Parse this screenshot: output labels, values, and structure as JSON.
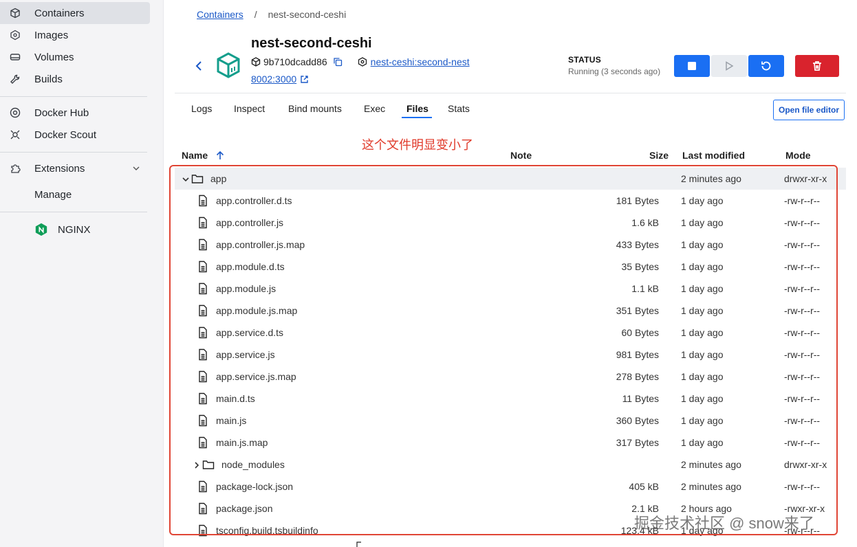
{
  "sidebar": {
    "items": [
      {
        "label": "Containers",
        "icon": "box-icon"
      },
      {
        "label": "Images",
        "icon": "image-icon"
      },
      {
        "label": "Volumes",
        "icon": "volume-icon"
      },
      {
        "label": "Builds",
        "icon": "wrench-icon"
      },
      {
        "label": "Docker Hub",
        "icon": "hub-icon"
      },
      {
        "label": "Docker Scout",
        "icon": "scout-icon"
      },
      {
        "label": "Extensions",
        "icon": "puzzle-icon"
      },
      {
        "label": "Manage"
      },
      {
        "label": "NGINX",
        "icon": "nginx-icon"
      }
    ]
  },
  "breadcrumb": {
    "parent": "Containers",
    "separator": "/",
    "current": "nest-second-ceshi"
  },
  "container": {
    "name": "nest-second-ceshi",
    "id": "9b710dcadd86",
    "image": "nest-ceshi:second-nest",
    "port": "8002:3000"
  },
  "status": {
    "label": "STATUS",
    "value": "Running (3 seconds ago)"
  },
  "tabs": [
    "Logs",
    "Inspect",
    "Bind mounts",
    "Exec",
    "Files",
    "Stats"
  ],
  "active_tab": "Files",
  "open_editor_label": "Open file editor",
  "annotation": "这个文件明显变小了",
  "table": {
    "headers": {
      "name": "Name",
      "note": "Note",
      "size": "Size",
      "modified": "Last modified",
      "mode": "Mode"
    },
    "rows": [
      {
        "name": "app",
        "type": "folder-open",
        "size": "",
        "modified": "2 minutes ago",
        "mode": "drwxr-xr-x"
      },
      {
        "name": "app.controller.d.ts",
        "type": "file",
        "size": "181 Bytes",
        "modified": "1 day ago",
        "mode": "-rw-r--r--"
      },
      {
        "name": "app.controller.js",
        "type": "file",
        "size": "1.6 kB",
        "modified": "1 day ago",
        "mode": "-rw-r--r--"
      },
      {
        "name": "app.controller.js.map",
        "type": "file",
        "size": "433 Bytes",
        "modified": "1 day ago",
        "mode": "-rw-r--r--"
      },
      {
        "name": "app.module.d.ts",
        "type": "file",
        "size": "35 Bytes",
        "modified": "1 day ago",
        "mode": "-rw-r--r--"
      },
      {
        "name": "app.module.js",
        "type": "file",
        "size": "1.1 kB",
        "modified": "1 day ago",
        "mode": "-rw-r--r--"
      },
      {
        "name": "app.module.js.map",
        "type": "file",
        "size": "351 Bytes",
        "modified": "1 day ago",
        "mode": "-rw-r--r--"
      },
      {
        "name": "app.service.d.ts",
        "type": "file",
        "size": "60 Bytes",
        "modified": "1 day ago",
        "mode": "-rw-r--r--"
      },
      {
        "name": "app.service.js",
        "type": "file",
        "size": "981 Bytes",
        "modified": "1 day ago",
        "mode": "-rw-r--r--"
      },
      {
        "name": "app.service.js.map",
        "type": "file",
        "size": "278 Bytes",
        "modified": "1 day ago",
        "mode": "-rw-r--r--"
      },
      {
        "name": "main.d.ts",
        "type": "file",
        "size": "11 Bytes",
        "modified": "1 day ago",
        "mode": "-rw-r--r--"
      },
      {
        "name": "main.js",
        "type": "file",
        "size": "360 Bytes",
        "modified": "1 day ago",
        "mode": "-rw-r--r--"
      },
      {
        "name": "main.js.map",
        "type": "file",
        "size": "317 Bytes",
        "modified": "1 day ago",
        "mode": "-rw-r--r--"
      },
      {
        "name": "node_modules",
        "type": "folder-closed",
        "size": "",
        "modified": "2 minutes ago",
        "mode": "drwxr-xr-x"
      },
      {
        "name": "package-lock.json",
        "type": "file",
        "size": "405 kB",
        "modified": "2 minutes ago",
        "mode": "-rw-r--r--"
      },
      {
        "name": "package.json",
        "type": "file",
        "size": "2.1 kB",
        "modified": "2 hours ago",
        "mode": "-rwxr-xr-x"
      },
      {
        "name": "tsconfig.build.tsbuildinfo",
        "type": "file",
        "size": "123.4 kB",
        "modified": "1 day ago",
        "mode": "-rw-r--r--"
      }
    ]
  },
  "watermark": "掘金技术社区 @ snow来了",
  "colors": {
    "accent": "#1a6ff3",
    "danger": "#d9232d",
    "annotation": "#e03a2a",
    "sidebar_bg": "#f4f4f6"
  }
}
